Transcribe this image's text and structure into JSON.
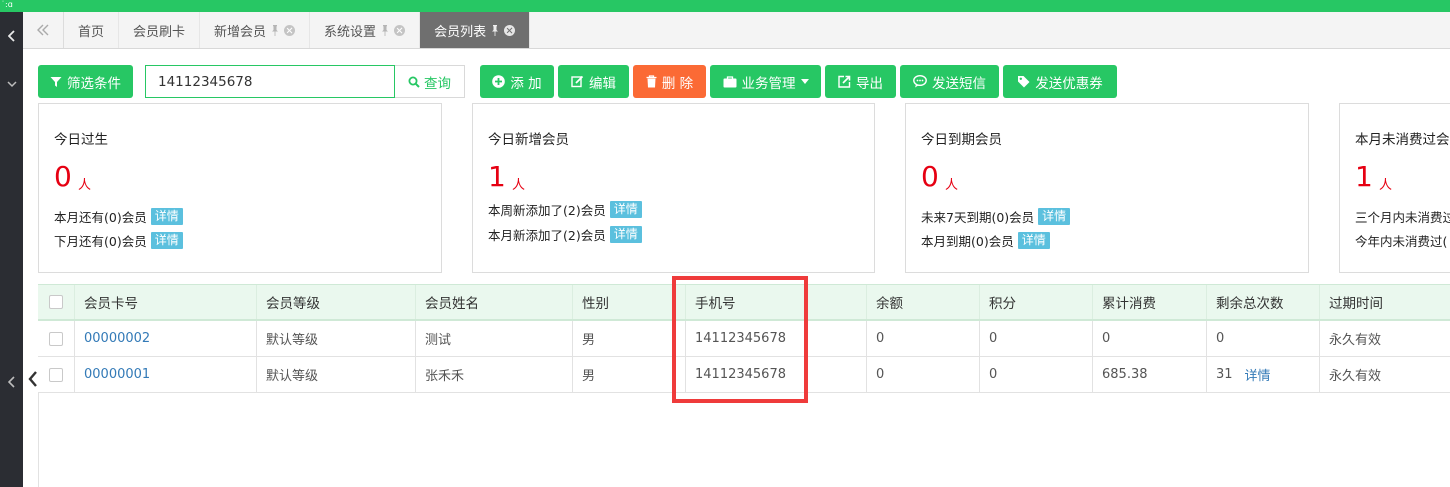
{
  "corner_glyph": "˙:ɑ",
  "tabs": [
    {
      "label": "首页",
      "pinned": false,
      "closable": false,
      "active": false
    },
    {
      "label": "会员刷卡",
      "pinned": false,
      "closable": false,
      "active": false
    },
    {
      "label": "新增会员",
      "pinned": true,
      "closable": true,
      "active": false
    },
    {
      "label": "系统设置",
      "pinned": true,
      "closable": true,
      "active": false
    },
    {
      "label": "会员列表",
      "pinned": true,
      "closable": true,
      "active": true
    }
  ],
  "toolbar": {
    "filter_label": "筛选条件",
    "search_value": "14112345678",
    "query_label": "查询",
    "add_label": "添 加",
    "edit_label": "编辑",
    "delete_label": "删 除",
    "business_label": "业务管理",
    "export_label": "导出",
    "sms_label": "发送短信",
    "coupon_label": "发送优惠券"
  },
  "cards": [
    {
      "title": "今日过生",
      "value": "0",
      "unit": "人",
      "line1": "本月还有(0)会员",
      "line2": "下月还有(0)会员",
      "detail": "详情"
    },
    {
      "title": "今日新增会员",
      "value": "1",
      "unit": "人",
      "line1": "本周新添加了(2)会员",
      "line2": "本月新添加了(2)会员",
      "detail": "详情"
    },
    {
      "title": "今日到期会员",
      "value": "0",
      "unit": "人",
      "line1": "未来7天到期(0)会员",
      "line2": "本月到期(0)会员",
      "detail": "详情"
    },
    {
      "title": "本月未消费过会",
      "value": "1",
      "unit": "人",
      "line1": "三个月内未消费过",
      "line2": "今年内未消费过("
    }
  ],
  "table": {
    "headers": [
      "会员卡号",
      "会员等级",
      "会员姓名",
      "性别",
      "手机号",
      "余额",
      "积分",
      "累计消费",
      "剩余总次数",
      "过期时间"
    ],
    "rows": [
      [
        "00000002",
        "默认等级",
        "测试",
        "男",
        "14112345678",
        "0",
        "0",
        "0",
        "0",
        "永久有效"
      ],
      [
        "00000001",
        "默认等级",
        "张禾禾",
        "男",
        "14112345678",
        "0",
        "0",
        "685.38",
        "31",
        "永久有效"
      ]
    ],
    "row2_detail": "详情"
  },
  "colors": {
    "accent": "#27c764",
    "danger": "#fb6a35",
    "value_red": "#e60012",
    "info": "#5bc0de",
    "highlight": "#ef3b3b"
  }
}
